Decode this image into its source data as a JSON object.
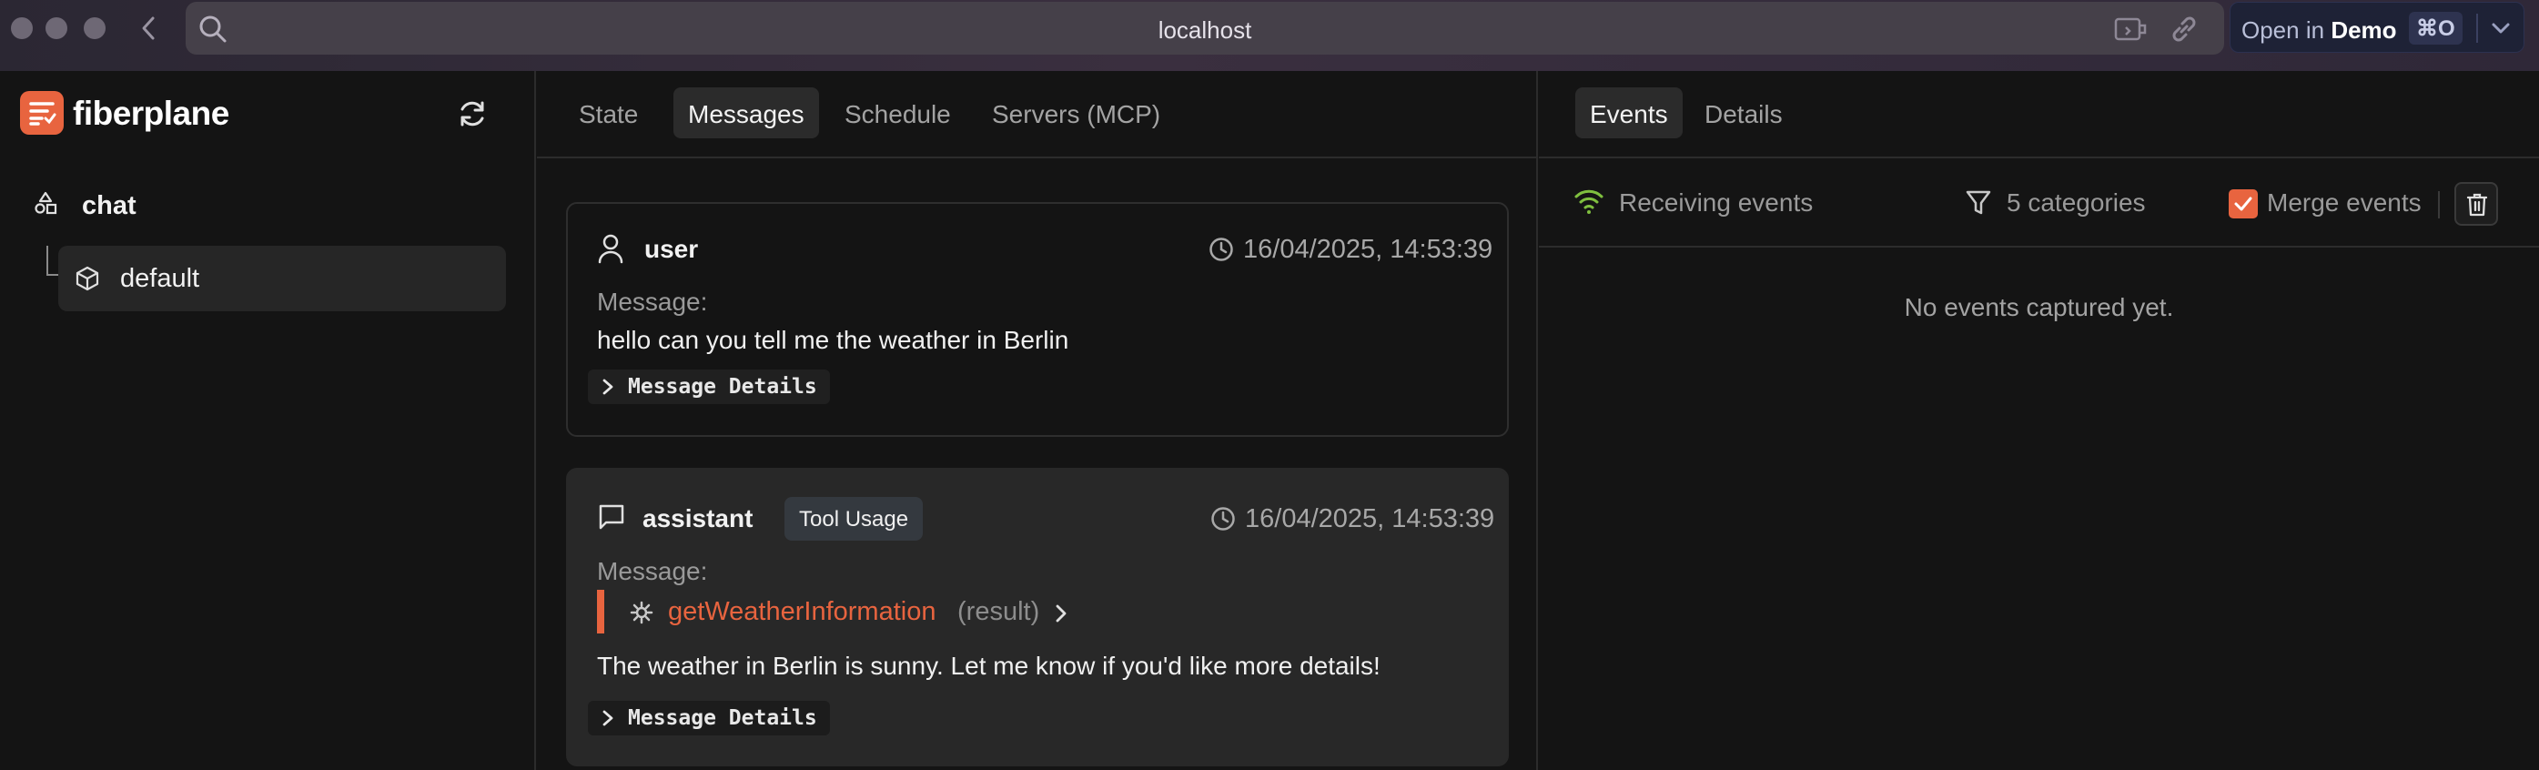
{
  "browser": {
    "url": "localhost",
    "open_in_prefix": "Open in",
    "open_in_target": "Demo",
    "shortcut": "⌘O"
  },
  "sidebar": {
    "brand": "fiberplane",
    "agent": "chat",
    "instance": "default"
  },
  "middle": {
    "tabs": [
      "State",
      "Messages",
      "Schedule",
      "Servers (MCP)"
    ],
    "active_tab": "Messages",
    "messages": [
      {
        "role": "user",
        "timestamp": "16/04/2025, 14:53:39",
        "label": "Message:",
        "text": "hello can you tell me the weather in Berlin",
        "details": "Message Details"
      },
      {
        "role": "assistant",
        "badge": "Tool Usage",
        "timestamp": "16/04/2025, 14:53:39",
        "label": "Message:",
        "tool_name": "getWeatherInformation",
        "tool_status": "(result)",
        "text": "The weather in Berlin is sunny. Let me know if you'd like more details!",
        "details": "Message Details"
      }
    ]
  },
  "right": {
    "tabs": [
      "Events",
      "Details"
    ],
    "active_tab": "Events",
    "status": "Receiving events",
    "filter": "5 categories",
    "merge_label": "Merge events",
    "merge_checked": true,
    "empty": "No events captured yet."
  },
  "colors": {
    "accent": "#e8643f",
    "signal": "#7fbf3f",
    "open_in_bg": "#1e2236"
  }
}
